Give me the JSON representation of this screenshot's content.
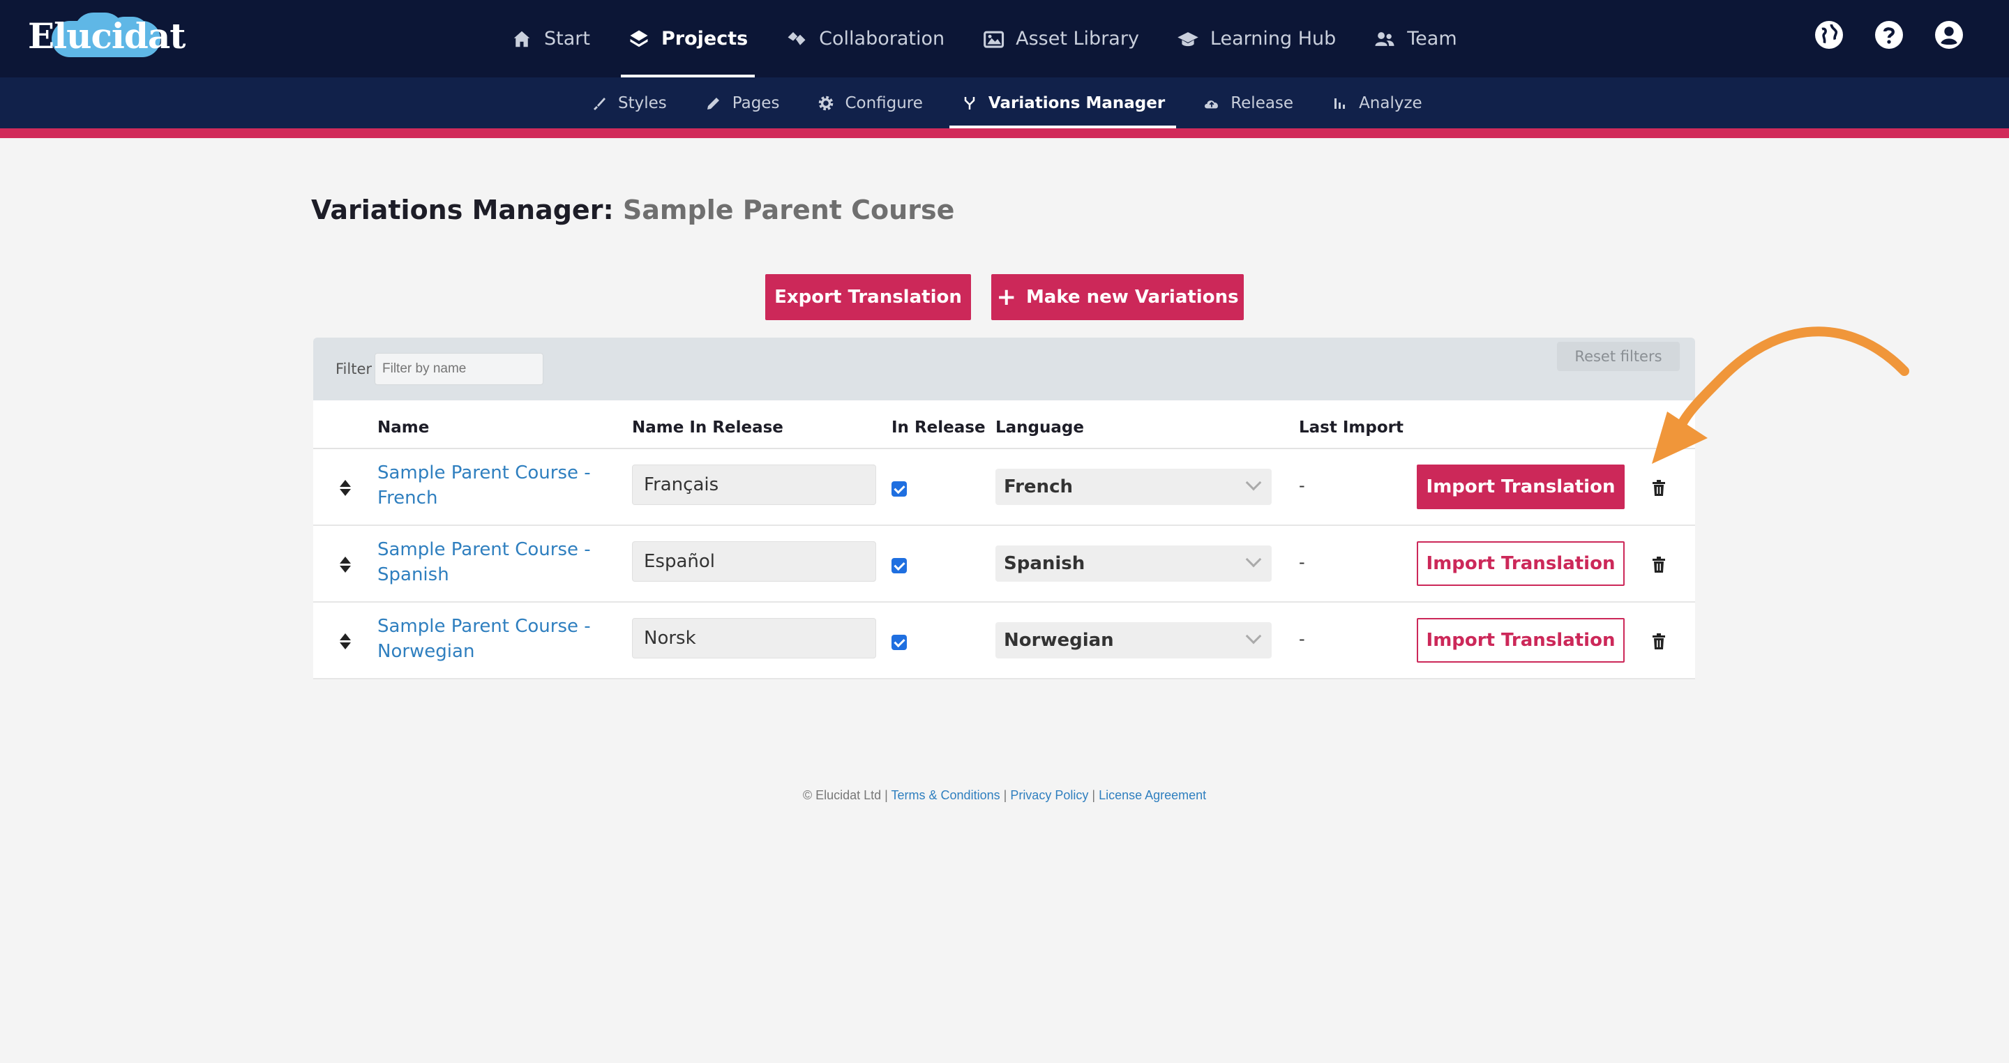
{
  "brand": {
    "logo_text": "Elucidat",
    "accent": "#cc2859",
    "nav_bg": "#0c1636",
    "subnav_bg": "#11214a",
    "link": "#2f7fbf"
  },
  "main_nav": {
    "items": [
      {
        "label": "Start",
        "icon": "home-icon"
      },
      {
        "label": "Projects",
        "icon": "layers-icon",
        "active": true
      },
      {
        "label": "Collaboration",
        "icon": "handshake-icon"
      },
      {
        "label": "Asset Library",
        "icon": "images-icon"
      },
      {
        "label": "Learning Hub",
        "icon": "graduation-cap-icon"
      },
      {
        "label": "Team",
        "icon": "users-icon"
      }
    ],
    "right_icons": [
      "globe-icon",
      "help-icon",
      "user-account-icon"
    ]
  },
  "sub_nav": {
    "items": [
      {
        "label": "Styles",
        "icon": "brush-icon"
      },
      {
        "label": "Pages",
        "icon": "pencil-icon"
      },
      {
        "label": "Configure",
        "icon": "gear-icon"
      },
      {
        "label": "Variations Manager",
        "icon": "fork-icon",
        "active": true
      },
      {
        "label": "Release",
        "icon": "cloud-upload-icon"
      },
      {
        "label": "Analyze",
        "icon": "bar-chart-icon"
      }
    ]
  },
  "page": {
    "title_prefix": "Variations Manager:",
    "course_name": "Sample Parent Course"
  },
  "actions": {
    "export_label": "Export Translation",
    "make_plus": "+",
    "make_label": "Make new Variations"
  },
  "filter": {
    "label": "Filter",
    "placeholder": "Filter by name",
    "reset_label": "Reset filters"
  },
  "table": {
    "headers": {
      "name": "Name",
      "name_in_release": "Name In Release",
      "in_release": "In Release",
      "language": "Language",
      "last_import": "Last Import"
    },
    "rows": [
      {
        "name": "Sample Parent Course - French",
        "release_name": "Français",
        "in_release": true,
        "language": "French",
        "last_import": "-",
        "import_label": "Import Translation",
        "highlighted": true
      },
      {
        "name": "Sample Parent Course - Spanish",
        "release_name": "Español",
        "in_release": true,
        "language": "Spanish",
        "last_import": "-",
        "import_label": "Import Translation",
        "highlighted": false
      },
      {
        "name": "Sample Parent Course - Norwegian",
        "release_name": "Norsk",
        "in_release": true,
        "language": "Norwegian",
        "last_import": "-",
        "import_label": "Import Translation",
        "highlighted": false
      }
    ]
  },
  "footer": {
    "copyright": "© Elucidat Ltd",
    "sep": "|",
    "terms": "Terms & Conditions",
    "privacy": "Privacy Policy",
    "license": "License Agreement"
  },
  "annotation": {
    "arrow_color": "#f0963a"
  }
}
